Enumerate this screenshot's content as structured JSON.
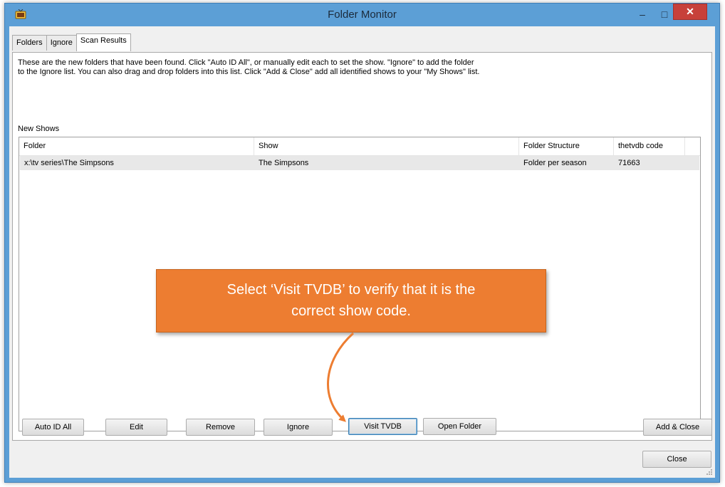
{
  "window": {
    "title": "Folder Monitor",
    "minimize_glyph": "–",
    "maximize_glyph": "□",
    "close_glyph": "✕"
  },
  "tabs": [
    {
      "label": "Folders"
    },
    {
      "label": "Ignore"
    },
    {
      "label": "Scan Results"
    }
  ],
  "description": {
    "line1": "These are the new folders that have been found.  Click \"Auto ID All\", or manually edit each to set the show.  \"Ignore\" to add the folder",
    "line2": "to the Ignore list.  You can also drag and drop folders into this list.  Click \"Add & Close\" add all identified shows to your \"My Shows\" list."
  },
  "new_shows_label": "New Shows",
  "table": {
    "columns": [
      "Folder",
      "Show",
      "Folder Structure",
      "thetvdb code"
    ],
    "rows": [
      {
        "folder": "x:\\tv series\\The Simpsons",
        "show": "The Simpsons",
        "structure": "Folder per season",
        "code": "71663"
      }
    ]
  },
  "buttons": {
    "auto_id_all": "Auto ID All",
    "edit": "Edit",
    "remove": "Remove",
    "ignore": "Ignore",
    "visit_tvdb": "Visit TVDB",
    "open_folder": "Open Folder",
    "add_close": "Add & Close",
    "close": "Close"
  },
  "callout": {
    "line1": "Select ‘Visit TVDB’ to verify that it is the",
    "line2": "correct show code."
  },
  "colors": {
    "titlebar": "#5c9fd6",
    "close_button": "#c7403a",
    "callout": "#ed7d31",
    "arrow": "#ed7d31"
  },
  "icons": {
    "app": "tv-icon",
    "minimize": "minimize-icon",
    "maximize": "maximize-icon",
    "close": "close-icon"
  }
}
